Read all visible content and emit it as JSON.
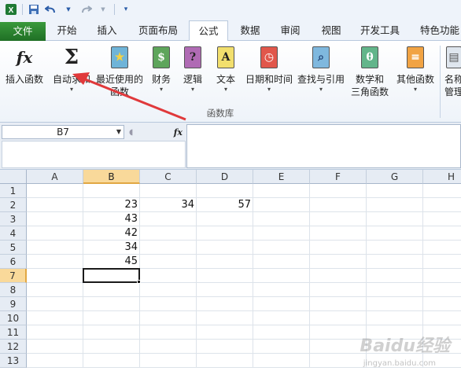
{
  "quick_access": {
    "icons": [
      "excel-icon",
      "save-icon",
      "undo-icon",
      "redo-icon",
      "customize-icon"
    ]
  },
  "tabs": [
    {
      "label": "文件"
    },
    {
      "label": "开始"
    },
    {
      "label": "插入"
    },
    {
      "label": "页面布局"
    },
    {
      "label": "公式"
    },
    {
      "label": "数据"
    },
    {
      "label": "审阅"
    },
    {
      "label": "视图"
    },
    {
      "label": "开发工具"
    },
    {
      "label": "特色功能"
    }
  ],
  "active_tab": "公式",
  "ribbon": {
    "group_label": "函数库",
    "buttons": [
      {
        "label": "插入函数",
        "label2": "",
        "icon": "fx-icon"
      },
      {
        "label": "自动求和",
        "label2": "",
        "icon": "sigma-icon"
      },
      {
        "label": "最近使用的",
        "label2": "函数",
        "icon": "recent-functions-icon"
      },
      {
        "label": "财务",
        "label2": "",
        "icon": "financial-icon"
      },
      {
        "label": "逻辑",
        "label2": "",
        "icon": "logical-icon"
      },
      {
        "label": "文本",
        "label2": "",
        "icon": "text-icon"
      },
      {
        "label": "日期和时间",
        "label2": "",
        "icon": "date-time-icon"
      },
      {
        "label": "查找与引用",
        "label2": "",
        "icon": "lookup-icon"
      },
      {
        "label": "数学和",
        "label2": "三角函数",
        "icon": "math-trig-icon"
      },
      {
        "label": "其他函数",
        "label2": "",
        "icon": "more-functions-icon"
      },
      {
        "label": "名称",
        "label2": "管理",
        "icon": "name-manager-icon"
      }
    ],
    "icon_glyphs": {
      "fx": "fx",
      "sigma": "Σ",
      "recent": "★",
      "financial": "$",
      "logical": "?",
      "text": "A",
      "date": "◷",
      "lookup": "⌕",
      "math": "θ",
      "more": "≡",
      "name": "▤"
    }
  },
  "formula_bar": {
    "name_box": "B7",
    "fx_label": "fx",
    "formula": ""
  },
  "grid": {
    "columns": [
      "A",
      "B",
      "C",
      "D",
      "E",
      "F",
      "G",
      "H"
    ],
    "rows": [
      "1",
      "2",
      "3",
      "4",
      "5",
      "6",
      "7",
      "8",
      "9",
      "10",
      "11",
      "12",
      "13"
    ],
    "selected_column": "B",
    "selected_row": "7",
    "cells": {
      "B2": "23",
      "C2": "34",
      "D2": "57",
      "B3": "43",
      "B4": "42",
      "B5": "34",
      "B6": "45"
    }
  },
  "colors": {
    "file_tab": "#2e7d32",
    "selection_header": "#f9d99a",
    "arrow": "#e0393b"
  },
  "watermark": "Baidu经验",
  "watermark_sub": "jingyan.baidu.com"
}
